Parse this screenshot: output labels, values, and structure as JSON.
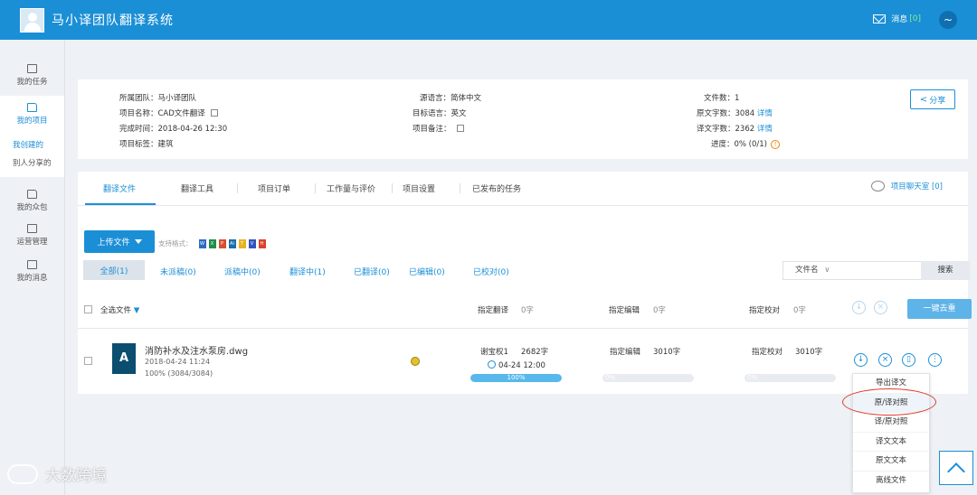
{
  "header": {
    "title": "马小译团队翻译系统",
    "msg_label": "消息",
    "msg_count": "[0]"
  },
  "sidebar": {
    "items": [
      {
        "label": "我的任务"
      },
      {
        "label": "我的项目"
      },
      {
        "label": "我创建的"
      },
      {
        "label": "别人分享的"
      },
      {
        "label": "我的众包"
      },
      {
        "label": "运营管理"
      },
      {
        "label": "我的消息"
      }
    ]
  },
  "project": {
    "team": "所属团队：马小译团队",
    "name": "项目名称：CAD文件翻译",
    "deadline": "完成时间：2018-04-26 12:30",
    "tags": "项目标签：建筑",
    "source_lang": "源语言：简体中文",
    "target_lang": "目标语言：英文",
    "note": "项目备注：",
    "file_count": "文件数：1",
    "source_words": "原文字数：3084",
    "target_words": "译文字数：2362",
    "progress": "进度：0% (0/1)",
    "detail_link": "详情",
    "share_label": "分享",
    "warn_glyph": "!"
  },
  "tabs": [
    {
      "label": "翻译文件"
    },
    {
      "label": "翻译工具"
    },
    {
      "label": "项目订单"
    },
    {
      "label": "工作量与评价"
    },
    {
      "label": "项目设置"
    },
    {
      "label": "已发布的任务"
    }
  ],
  "chat_label": "项目聊天室 [0]",
  "toolbar": {
    "upload_label": "上传文件",
    "formats_label": "支持格式："
  },
  "format_icons": [
    {
      "glyph": "W",
      "color": "#2b6cc4"
    },
    {
      "glyph": "X",
      "color": "#1f8f4a"
    },
    {
      "glyph": "P",
      "color": "#d35230"
    },
    {
      "glyph": "Ai",
      "color": "#1b6fa8"
    },
    {
      "glyph": "T",
      "color": "#e6b322"
    },
    {
      "glyph": "V",
      "color": "#3355bb"
    },
    {
      "glyph": "H",
      "color": "#d9432f"
    }
  ],
  "filters": [
    {
      "label": "全部(1)"
    },
    {
      "label": "未派稿(0)"
    },
    {
      "label": "派稿中(0)"
    },
    {
      "label": "翻译中(1)"
    },
    {
      "label": "已翻译(0)"
    },
    {
      "label": "已编辑(0)"
    },
    {
      "label": "已校对(0)"
    }
  ],
  "search": {
    "field_label": "文件名",
    "button_label": "搜索"
  },
  "table_header": {
    "select_all": "全选文件",
    "assign_translate": "指定翻译",
    "assign_translate_count": "0字",
    "assign_edit": "指定编辑",
    "assign_edit_count": "0字",
    "assign_proof": "指定校对",
    "assign_proof_count": "0字",
    "clear_label": "一键去重"
  },
  "file": {
    "name": "消防补水及注水泵房.dwg",
    "date": "2018-04-24 11:24",
    "progress_text": "100% (3084/3084)",
    "translator": "谢宝权1",
    "translator_words": "2682字",
    "due": "04-24 12:00",
    "translate_progress": 1.0,
    "translate_label": "100%",
    "edit_label": "指定编辑",
    "edit_words": "3010字",
    "edit_progress": 0.0,
    "edit_bar_label": "0%",
    "proof_label": "指定校对",
    "proof_words": "3010字",
    "proof_progress": 0.0,
    "proof_bar_label": "0%"
  },
  "dropdown": {
    "items": [
      {
        "label": "导出译文"
      },
      {
        "label": "原/译对照"
      },
      {
        "label": "译/原对照"
      },
      {
        "label": "译文文本"
      },
      {
        "label": "原文文本"
      },
      {
        "label": "离线文件"
      }
    ]
  },
  "watermark": "大数跨境"
}
